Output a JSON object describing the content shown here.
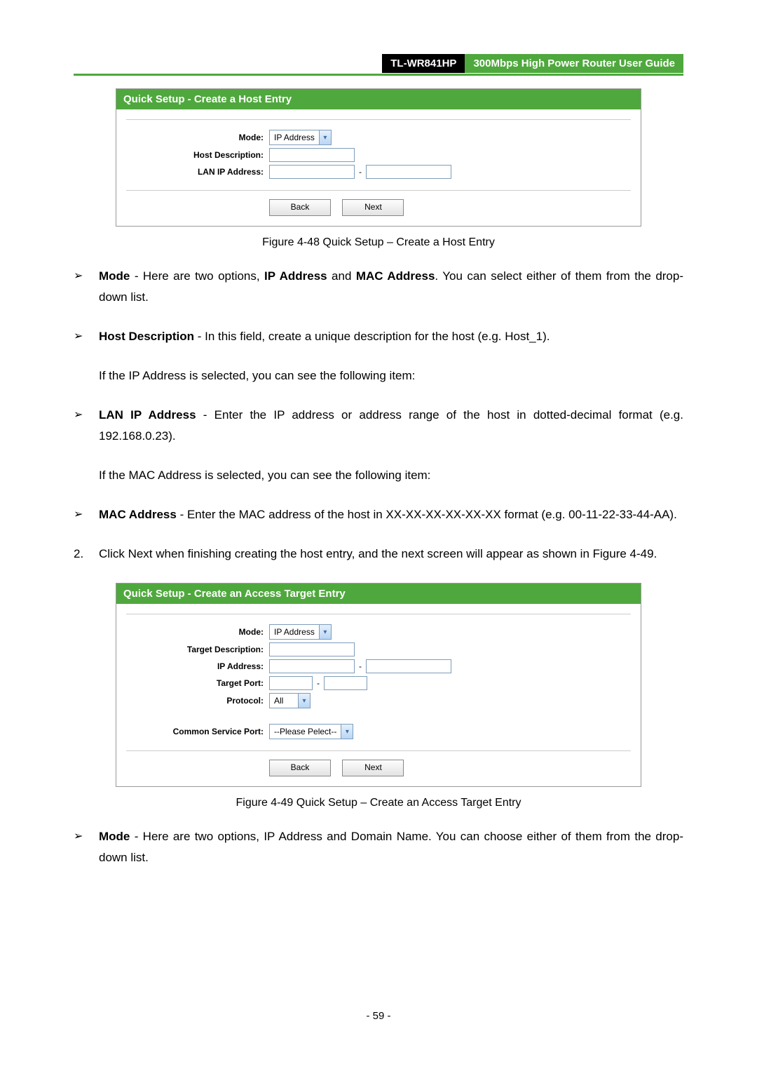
{
  "header": {
    "model": "TL-WR841HP",
    "subtitle": "300Mbps High Power Router User Guide"
  },
  "panel1": {
    "title": "Quick Setup - Create a Host Entry",
    "labels": {
      "mode": "Mode:",
      "host_desc": "Host Description:",
      "lan_ip": "LAN IP Address:"
    },
    "mode_value": "IP Address",
    "back": "Back",
    "next": "Next"
  },
  "caption1": "Figure 4-48    Quick Setup – Create a Host Entry",
  "bullets_a": {
    "b1_bold": "Mode",
    "b1_rest_a": " - Here are two options, ",
    "b1_bold2": "IP Address",
    "b1_mid": " and ",
    "b1_bold3": "MAC Address",
    "b1_rest_b": ". You can select either of them from the drop-down list.",
    "b2_bold": "Host Description",
    "b2_rest": " - In this field, create a unique description for the host (e.g. Host_1).",
    "para_if_ip_a": "If the ",
    "para_if_ip_bold": "IP Address",
    "para_if_ip_b": " is selected, you can see the following item:",
    "b3_bold": "LAN IP Address",
    "b3_rest": " - Enter the IP address or address range of the host in dotted-decimal format (e.g. 192.168.0.23).",
    "para_if_mac": "If the MAC Address is selected, you can see the following item:",
    "b4_bold": "MAC  Address",
    "b4_rest": "  -  Enter  the  MAC  address  of  the  host  in  XX-XX-XX-XX-XX-XX  format  (e.g. 00-11-22-33-44-AA)."
  },
  "step2": {
    "num": "2.",
    "text_a": "Click ",
    "bold": "Next",
    "text_b": " when finishing creating the host entry, and the next screen will appear as shown in Figure 4-49."
  },
  "panel2": {
    "title": "Quick Setup - Create an Access Target Entry",
    "labels": {
      "mode": "Mode:",
      "target_desc": "Target Description:",
      "ip_addr": "IP Address:",
      "target_port": "Target Port:",
      "protocol": "Protocol:",
      "common_port": "Common Service Port:"
    },
    "mode_value": "IP Address",
    "protocol_value": "All",
    "common_port_value": "--Please Pelect--",
    "back": "Back",
    "next": "Next"
  },
  "caption2": "Figure 4-49    Quick Setup – Create an Access Target Entry",
  "bullets_b": {
    "b1_bold": "Mode",
    "b1_rest": " - Here are two options, IP Address and Domain Name. You can choose either of them from the drop-down list."
  },
  "page_number": "- 59 -",
  "chart_data": null
}
